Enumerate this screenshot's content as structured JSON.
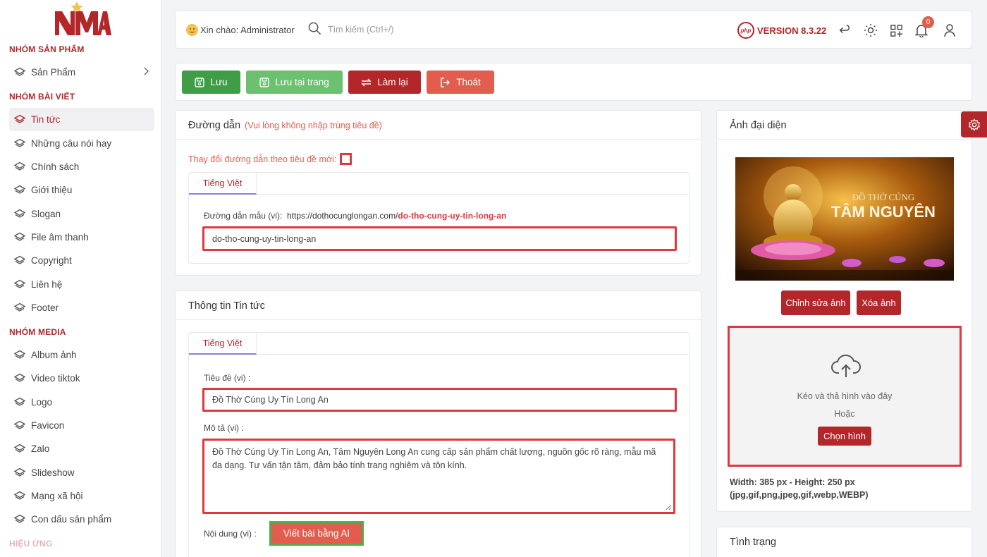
{
  "sidebar": {
    "groups": [
      "NHÓM SẢN PHẨM",
      "NHÓM BÀI VIẾT",
      "NHÓM MEDIA",
      "HIỆU ỨNG"
    ],
    "items": [
      {
        "label": "Sản Phẩm",
        "active": false,
        "has_children": true
      },
      {
        "label": "Tin tức",
        "active": true
      },
      {
        "label": "Những câu nói hay",
        "active": false
      },
      {
        "label": "Chính sách",
        "active": false
      },
      {
        "label": "Giới thiệu",
        "active": false
      },
      {
        "label": "Slogan",
        "active": false
      },
      {
        "label": "File âm thanh",
        "active": false
      },
      {
        "label": "Copyright",
        "active": false
      },
      {
        "label": "Liên hệ",
        "active": false
      },
      {
        "label": "Footer",
        "active": false
      },
      {
        "label": "Album ảnh",
        "active": false
      },
      {
        "label": "Video tiktok",
        "active": false
      },
      {
        "label": "Logo",
        "active": false
      },
      {
        "label": "Favicon",
        "active": false
      },
      {
        "label": "Zalo",
        "active": false
      },
      {
        "label": "Slideshow",
        "active": false
      },
      {
        "label": "Mạng xã hội",
        "active": false
      },
      {
        "label": "Con dấu sản phẩm",
        "active": false
      }
    ]
  },
  "header": {
    "greeting": "Xin chào: Administrator",
    "search_placeholder": "Tìm kiếm (Ctrl+/)",
    "php_badge": "php",
    "version": "VERSION 8.3.22",
    "notification_count": "0",
    "icons": [
      "return-icon",
      "sun-icon",
      "apps-icon",
      "bell-icon",
      "user-icon"
    ]
  },
  "toolbar": {
    "save": "Lưu",
    "save_stay": "Lưu tại trang",
    "reset": "Làm lại",
    "exit": "Thoát"
  },
  "slug_card": {
    "title": "Đường dẫn",
    "note": "(Vui lòng không nhập trùng tiêu đề)",
    "change_label": "Thay đổi đường dẫn theo tiêu đề mới:",
    "tab": "Tiếng Việt",
    "sample_label": "Đường dẫn mẫu (vi):",
    "sample_base": "https://dothocunglongan.com/",
    "sample_slug": "do-tho-cung-uy-tin-long-an",
    "slug_value": "do-tho-cung-uy-tin-long-an"
  },
  "info_card": {
    "title": "Thông tin Tin tức",
    "tab": "Tiếng Việt",
    "title_label": "Tiêu đề (vi) :",
    "title_value": "Đồ Thờ Cúng Uy Tín Long An",
    "desc_label": "Mô tả (vi) :",
    "desc_value": "Đồ Thờ Cúng Uy Tín Long An, Tâm Nguyên Long An cung cấp sản phẩm chất lượng, nguồn gốc rõ ràng, mẫu mã đa dạng. Tư vấn tận tâm, đảm bảo tính trang nghiêm và tôn kính.",
    "content_label": "Nội dung (vi) :",
    "ai_button": "Viết bài bằng AI"
  },
  "image_card": {
    "title": "Ảnh đại diện",
    "image_line1": "ĐỒ THỜ CÚNG",
    "image_line2": "TÂM NGUYÊN",
    "edit_button": "Chỉnh sửa ảnh",
    "delete_button": "Xóa ảnh",
    "drop_text": "Kéo và thả hình vào đây",
    "or_text": "Hoặc",
    "choose_button": "Chọn hình",
    "size_text": "Width: 385 px - Height: 250 px",
    "ext_text": "(jpg,gif,png,jpeg,gif,webp,WEBP)"
  },
  "status_card": {
    "title": "Tình trạng"
  },
  "colors": {
    "brand": "#b3262a",
    "save": "#3f9d48",
    "save_stay": "#6cc06f",
    "reset": "#b3262a",
    "exit": "#e35d4f",
    "highlight": "#e0383e",
    "ai_button": "#e35d4f"
  }
}
